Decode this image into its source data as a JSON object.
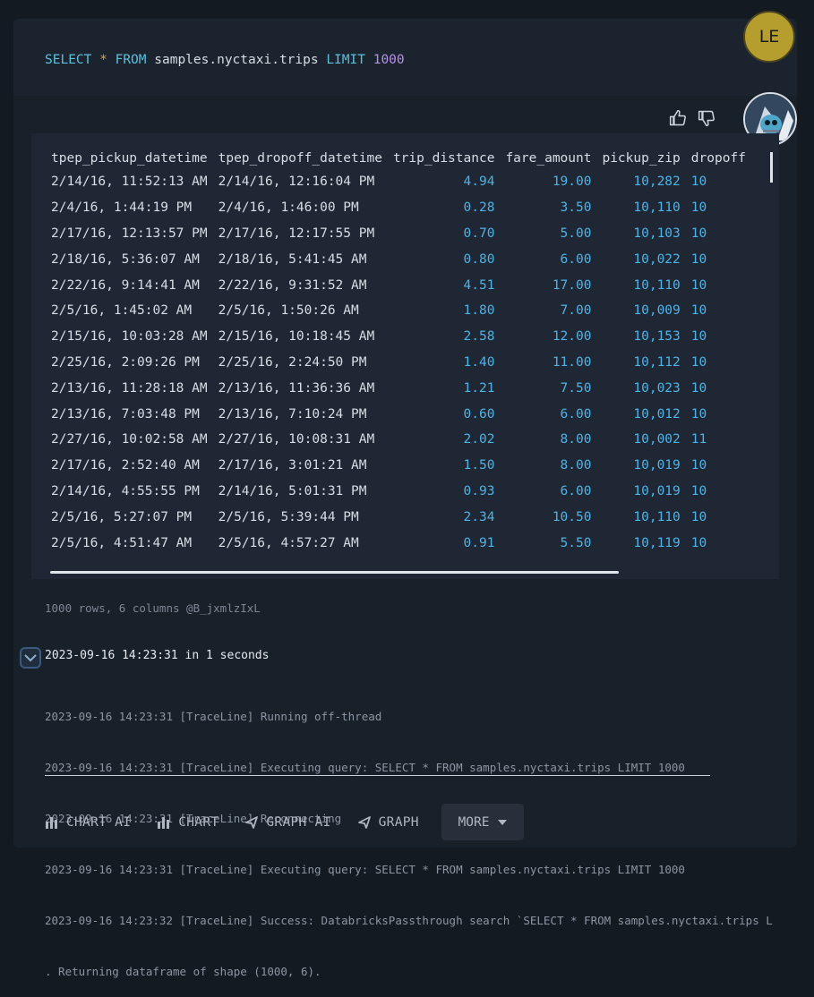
{
  "query": {
    "select_kw": "SELECT",
    "star": "*",
    "from_kw": "FROM",
    "table_db": "samples",
    "dot1": ".",
    "table_schema": "nyctaxi",
    "dot2": ".",
    "table_name": "trips",
    "limit_kw": "LIMIT",
    "limit_val": "1000"
  },
  "user_avatar": {
    "initials": "LE"
  },
  "bot_avatar": {
    "icon": "robot-avatar-icon"
  },
  "feedback": {
    "up_icon": "thumbs-up-icon",
    "down_icon": "thumbs-down-icon"
  },
  "table": {
    "columns": [
      "tpep_pickup_datetime",
      "tpep_dropoff_datetime",
      "trip_distance",
      "fare_amount",
      "pickup_zip",
      "dropoff"
    ],
    "rows": [
      [
        "2/14/16, 11:52:13 AM",
        "2/14/16, 12:16:04 PM",
        "4.94",
        "19.00",
        "10,282",
        "10"
      ],
      [
        "2/4/16, 1:44:19 PM",
        "2/4/16, 1:46:00 PM",
        "0.28",
        "3.50",
        "10,110",
        "10"
      ],
      [
        "2/17/16, 12:13:57 PM",
        "2/17/16, 12:17:55 PM",
        "0.70",
        "5.00",
        "10,103",
        "10"
      ],
      [
        "2/18/16, 5:36:07 AM",
        "2/18/16, 5:41:45 AM",
        "0.80",
        "6.00",
        "10,022",
        "10"
      ],
      [
        "2/22/16, 9:14:41 AM",
        "2/22/16, 9:31:52 AM",
        "4.51",
        "17.00",
        "10,110",
        "10"
      ],
      [
        "2/5/16, 1:45:02 AM",
        "2/5/16, 1:50:26 AM",
        "1.80",
        "7.00",
        "10,009",
        "10"
      ],
      [
        "2/15/16, 10:03:28 AM",
        "2/15/16, 10:18:45 AM",
        "2.58",
        "12.00",
        "10,153",
        "10"
      ],
      [
        "2/25/16, 2:09:26 PM",
        "2/25/16, 2:24:50 PM",
        "1.40",
        "11.00",
        "10,112",
        "10"
      ],
      [
        "2/13/16, 11:28:18 AM",
        "2/13/16, 11:36:36 AM",
        "1.21",
        "7.50",
        "10,023",
        "10"
      ],
      [
        "2/13/16, 7:03:48 PM",
        "2/13/16, 7:10:24 PM",
        "0.60",
        "6.00",
        "10,012",
        "10"
      ],
      [
        "2/27/16, 10:02:58 AM",
        "2/27/16, 10:08:31 AM",
        "2.02",
        "8.00",
        "10,002",
        "11"
      ],
      [
        "2/17/16, 2:52:40 AM",
        "2/17/16, 3:01:21 AM",
        "1.50",
        "8.00",
        "10,019",
        "10"
      ],
      [
        "2/14/16, 4:55:55 PM",
        "2/14/16, 5:01:31 PM",
        "0.93",
        "6.00",
        "10,019",
        "10"
      ],
      [
        "2/5/16, 5:27:07 PM",
        "2/5/16, 5:39:44 PM",
        "2.34",
        "10.50",
        "10,110",
        "10"
      ],
      [
        "2/5/16, 4:51:47 AM",
        "2/5/16, 4:57:27 AM",
        "0.91",
        "5.50",
        "10,119",
        "10"
      ]
    ]
  },
  "result_info": "1000 rows, 6 columns @B_jxmlzIxL",
  "timing": "2023-09-16 14:23:31 in 1 seconds",
  "log_lines": [
    "2023-09-16 14:23:31 [TraceLine] Running off-thread",
    "2023-09-16 14:23:31 [TraceLine] Executing query: SELECT * FROM samples.nyctaxi.trips LIMIT 1000",
    "2023-09-16 14:23:31 [TraceLine] Reconnecting",
    "2023-09-16 14:23:31 [TraceLine] Executing query: SELECT * FROM samples.nyctaxi.trips LIMIT 1000",
    "2023-09-16 14:23:32 [TraceLine] Success: DatabricksPassthrough search `SELECT * FROM samples.nyctaxi.trips L",
    ". Returning dataframe of shape (1000, 6)."
  ],
  "toolbar": {
    "chart_ai": "CHART AI",
    "chart": "CHART",
    "graph_ai": "GRAPH AI",
    "graph": "GRAPH",
    "more": "MORE"
  },
  "colors": {
    "accent": "#4fb3e8",
    "keyword": "#5bc0de",
    "avatar": "#b59e2e"
  }
}
